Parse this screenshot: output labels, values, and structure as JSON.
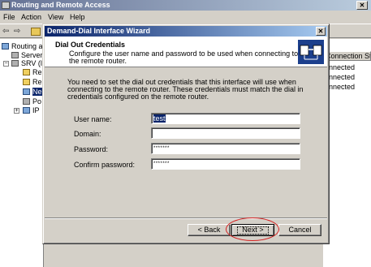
{
  "main_window": {
    "title": "Routing and Remote Access",
    "close_glyph": "✕",
    "menu": [
      "File",
      "Action",
      "View",
      "Help"
    ],
    "toolbar": {
      "back_glyph": "⇦",
      "forward_glyph": "⇨"
    },
    "tree": {
      "items": [
        {
          "label": "Routing an",
          "icon": "routing-icon"
        },
        {
          "label": "Server",
          "icon": "server-status-icon"
        },
        {
          "label": "SRV (lc",
          "icon": "server-icon",
          "expander": "−"
        },
        {
          "label": "Re",
          "icon": "folder-icon"
        },
        {
          "label": "Re",
          "icon": "folder-icon"
        },
        {
          "label": "Ne",
          "icon": "network-interfaces-icon"
        },
        {
          "label": "Po",
          "icon": "ports-icon"
        },
        {
          "label": "IP",
          "icon": "ip-routing-icon",
          "expander": "+"
        }
      ]
    },
    "list": {
      "column_header": "Connection State",
      "cells": [
        "onnected",
        "onnected",
        "onnected"
      ]
    }
  },
  "dialog": {
    "title": "Demand-Dial Interface Wizard",
    "close_glyph": "✕",
    "header": {
      "title": "Dial Out Credentials",
      "subtitle": "Configure the user name and password to be used when connecting to the remote router."
    },
    "body_text": "You need to set the dial out credentials that this interface will use when connecting to the remote router.  These credentials must match the dial in credentials configured on the remote router.",
    "fields": {
      "username": {
        "label": "User name:",
        "value": "test"
      },
      "domain": {
        "label": "Domain:",
        "value": ""
      },
      "password": {
        "label": "Password:",
        "value": "*******"
      },
      "confirm_password": {
        "label": "Confirm password:",
        "value": "*******"
      }
    },
    "buttons": {
      "back": "< Back",
      "next": "Next >",
      "cancel": "Cancel"
    }
  },
  "colors": {
    "title_bar": "#0a246a",
    "highlight_circle": "#d42020",
    "header_graphic": "#1c3f8c"
  }
}
